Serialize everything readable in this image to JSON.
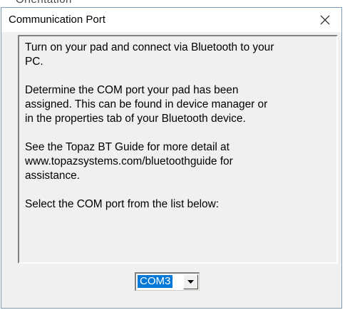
{
  "background_window": {
    "partial_title": "Orientation"
  },
  "dialog": {
    "title": "Communication Port",
    "close_icon": "close-icon"
  },
  "instructions": {
    "paragraphs": [
      "Turn on your pad and connect via Bluetooth to your\nPC.",
      "Determine the COM port your pad has been\nassigned. This can be found in device manager or\nin the properties tab of your Bluetooth device.",
      "See the Topaz BT Guide for more detail at\nwww.topazsystems.com/bluetoothguide for\nassistance.",
      "Select the COM port from the list below:"
    ]
  },
  "com_port_select": {
    "selected": "COM3",
    "arrow_icon": "chevron-down-icon"
  },
  "colors": {
    "selection": "#0078d7",
    "dialog_background": "#f0f0f0",
    "titlebar": "#ffffff"
  }
}
